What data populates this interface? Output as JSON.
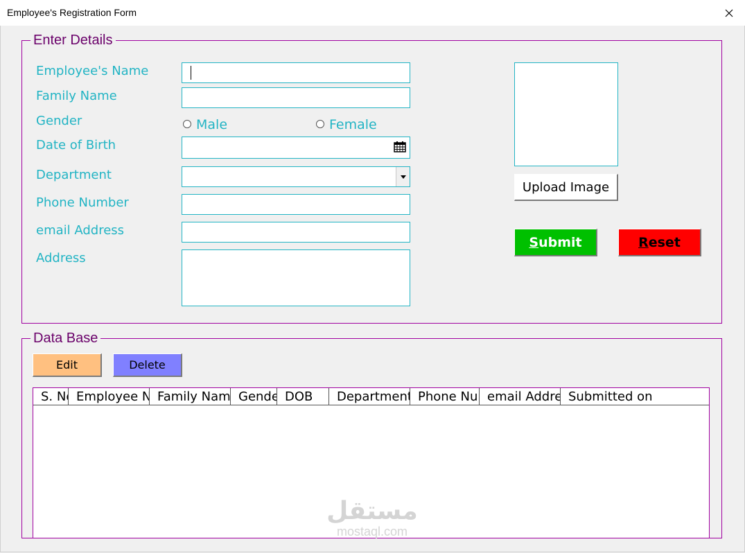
{
  "window": {
    "title": "Employee's Registration Form",
    "close_icon": "close-icon"
  },
  "details": {
    "legend": "Enter Details",
    "labels": {
      "name": "Employee's Name",
      "family": "Family Name",
      "gender": "Gender",
      "dob": "Date of Birth",
      "department": "Department",
      "phone": "Phone Number",
      "email": "email Address",
      "address": "Address"
    },
    "values": {
      "name": "",
      "family": "",
      "dob": "",
      "department": "",
      "phone": "",
      "email": "",
      "address": ""
    },
    "gender_options": [
      "Male",
      "Female"
    ],
    "upload_label": "Upload Image",
    "submit_label": {
      "accel": "S",
      "rest": "ubmit"
    },
    "reset_label": {
      "accel": "R",
      "rest": "eset"
    }
  },
  "database": {
    "legend": "Data Base",
    "edit_label": "Edit",
    "delete_label": "Delete",
    "columns": [
      "S. No.",
      "Employee Name",
      "Family Name",
      "Gender",
      "DOB",
      "Department",
      "Phone Number",
      "email Address",
      "Submitted on"
    ],
    "rows": []
  },
  "watermark": {
    "arabic": "مستقل",
    "latin": "mostaql.com"
  },
  "colors": {
    "label": "#22b4c4",
    "frame": "#a000a0",
    "submit_bg": "#00c000",
    "reset_bg": "#ff0000",
    "edit_bg": "#ffc080",
    "delete_bg": "#8080ff"
  }
}
